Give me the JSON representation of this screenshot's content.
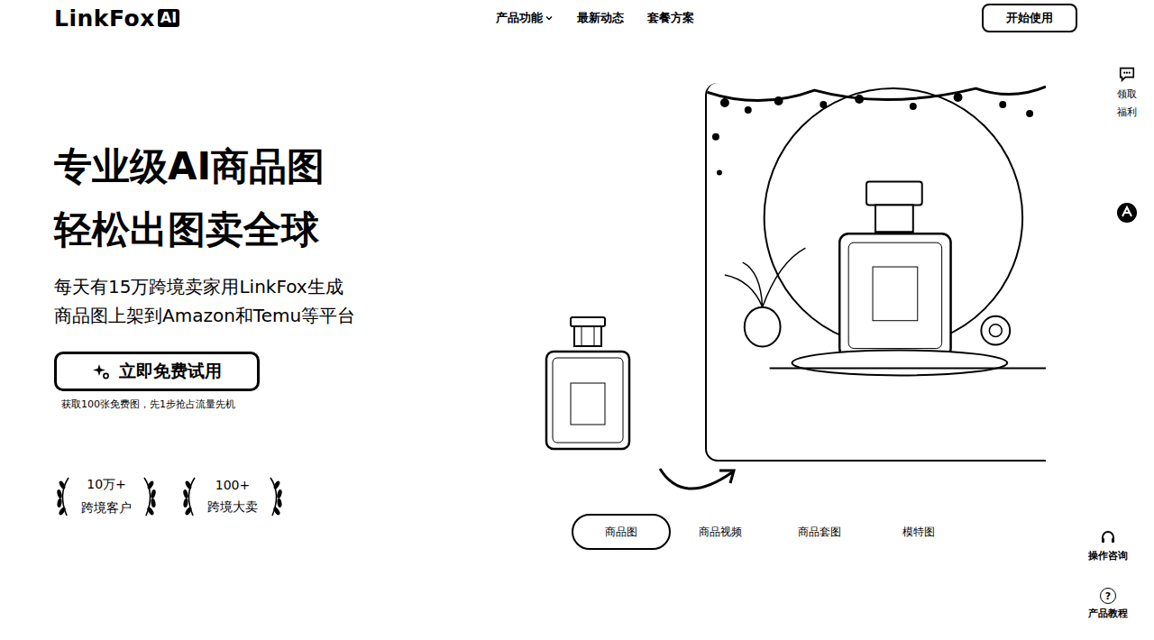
{
  "logo": {
    "name": "LinkFox",
    "badge": "AI"
  },
  "nav": {
    "items": [
      {
        "label": "产品功能",
        "has_dropdown": true
      },
      {
        "label": "最新动态",
        "has_dropdown": false
      },
      {
        "label": "套餐方案",
        "has_dropdown": false
      }
    ],
    "cta": "开始使用"
  },
  "hero": {
    "title_lines": [
      "专业级AI商品图",
      "轻松出图卖全球"
    ],
    "subtitle_lines": [
      "每天有15万跨境卖家用LinkFox生成",
      "商品图上架到Amazon和Temu等平台"
    ],
    "button": "立即免费试用",
    "note": "获取100张免费图，先1步抢占流量先机",
    "stats": [
      {
        "value": "10万+",
        "label": "跨境客户"
      },
      {
        "value": "100+",
        "label": "跨境大卖"
      }
    ]
  },
  "showcase": {
    "tabs": [
      {
        "label": "商品图",
        "selected": true
      },
      {
        "label": "商品视频",
        "selected": false
      },
      {
        "label": "商品套图",
        "selected": false
      },
      {
        "label": "模特图",
        "selected": false
      }
    ]
  },
  "side_bar": {
    "top": [
      {
        "kind": "chat",
        "label": "领取福利"
      },
      {
        "kind": "logo"
      }
    ],
    "bottom": [
      {
        "kind": "headset",
        "label": "操作咨询"
      },
      {
        "kind": "help",
        "icon": "?",
        "label": "产品教程"
      }
    ]
  }
}
